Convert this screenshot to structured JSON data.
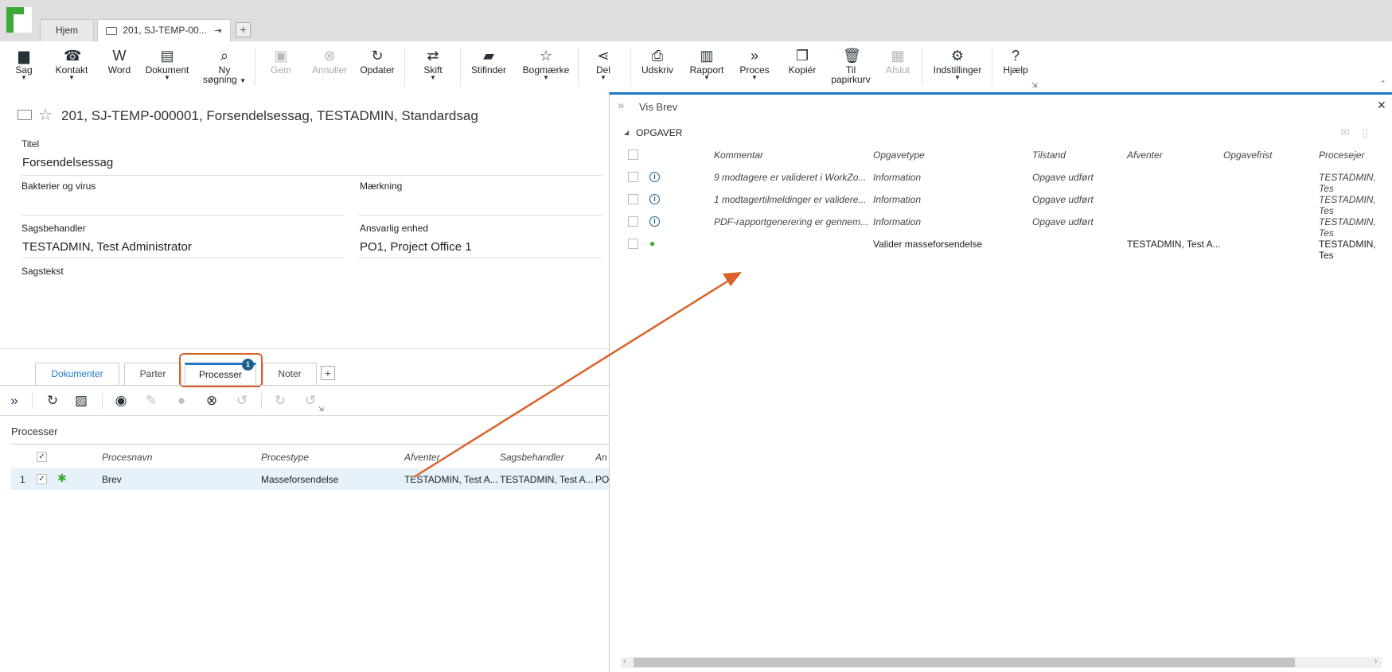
{
  "tabs": {
    "home": "Hjem",
    "case": "201, SJ-TEMP-00..."
  },
  "ribbon": {
    "sag": "Sag",
    "kontakt": "Kontakt",
    "word": "Word",
    "dokument": "Dokument",
    "ny_soegning_1": "Ny",
    "ny_soegning_2": "søgning",
    "gem": "Gem",
    "annuller": "Annuller",
    "opdater": "Opdater",
    "skift": "Skift",
    "stifinder": "Stifinder",
    "bogmaerke": "Bogmærke",
    "del": "Del",
    "udskriv": "Udskriv",
    "rapport": "Rapport",
    "proces": "Proces",
    "kopier": "Kopiér",
    "til_papirkurv_1": "Til",
    "til_papirkurv_2": "papirkurv",
    "afslut": "Afslut",
    "indstillinger": "Indstillinger",
    "hjaelp": "Hjælp"
  },
  "case": {
    "title": "201, SJ-TEMP-000001, Forsendelsessag, TESTADMIN, Standardsag",
    "titel_label": "Titel",
    "titel_value": "Forsendelsessag",
    "bakterier_label": "Bakterier og virus",
    "maerkning_label": "Mærkning",
    "sagsbehandler_label": "Sagsbehandler",
    "sagsbehandler_value": "TESTADMIN, Test Administrator",
    "ansvarlig_label": "Ansvarlig enhed",
    "ansvarlig_value": "PO1, Project Office 1",
    "sagstekst_label": "Sagstekst"
  },
  "bottom_tabs": {
    "dokumenter": "Dokumenter",
    "parter": "Parter",
    "processer": "Processer",
    "processer_badge": "1",
    "noter": "Noter"
  },
  "processes": {
    "section_title": "Processer",
    "columns": [
      "Procesnavn",
      "Procestype",
      "Afventer",
      "Sagsbehandler",
      "An"
    ],
    "row": {
      "num": "1",
      "name": "Brev",
      "type": "Masseforsendelse",
      "afventer": "TESTADMIN, Test A...",
      "sagsbehandler": "TESTADMIN, Test A...",
      "an": "PO"
    }
  },
  "panel": {
    "title": "Vis Brev",
    "section": "OPGAVER",
    "columns": [
      "Kommentar",
      "Opgavetype",
      "Tilstand",
      "Afventer",
      "Opgavefrist",
      "Procesejer"
    ],
    "rows": [
      {
        "kommentar": "9 modtagere er valideret i WorkZo...",
        "type": "Information",
        "tilstand": "Opgave udført",
        "afventer": "",
        "frist": "",
        "ejer": "TESTADMIN, Tes"
      },
      {
        "kommentar": "1 modtagertilmeldinger er validere...",
        "type": "Information",
        "tilstand": "Opgave udført",
        "afventer": "",
        "frist": "",
        "ejer": "TESTADMIN, Tes"
      },
      {
        "kommentar": "PDF-rapportgenerering er gennem...",
        "type": "Information",
        "tilstand": "Opgave udført",
        "afventer": "",
        "frist": "",
        "ejer": "TESTADMIN, Tes"
      },
      {
        "kommentar": "",
        "type": "Valider masseforsendelse",
        "tilstand": "",
        "afventer": "TESTADMIN, Test A...",
        "frist": "",
        "ejer": "TESTADMIN, Tes"
      }
    ]
  },
  "colors": {
    "accent": "#1e7ac7",
    "highlight": "#d9622b",
    "row_selected": "#e6f1fa"
  }
}
